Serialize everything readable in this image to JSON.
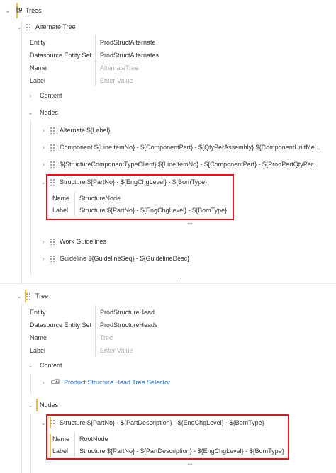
{
  "root": {
    "title": "Trees"
  },
  "alternate_tree": {
    "title": "Alternate Tree",
    "props": [
      {
        "key": "Entity",
        "value": "ProdStructAlternate",
        "placeholder": false
      },
      {
        "key": "Datasource Entity Set",
        "value": "ProdStructAlternates",
        "placeholder": false
      },
      {
        "key": "Name",
        "value": "AlternateTree",
        "placeholder": true
      },
      {
        "key": "Label",
        "value": "Enter Value",
        "placeholder": true
      }
    ],
    "content_label": "Content",
    "nodes_label": "Nodes",
    "nodes": [
      "Alternate ${Label}",
      "Component ${LineItemNo} - ${ComponentPart} - ${QtyPerAssembly} ${ComponentUnitMe...",
      "${StructureComponentTypeClient} ${LineItemNo} - ${ComponentPart} - ${ProdPartQtyPer...",
      "Structure ${PartNo} - ${EngChgLevel} - ${BomType}",
      "Work Guidelines",
      "Guideline ${GuidelineSeq} - ${GuidelineDesc}"
    ],
    "structure_props": [
      {
        "key": "Name",
        "value": "StructureNode"
      },
      {
        "key": "Label",
        "value": "Structure ${PartNo} - ${EngChgLevel} - ${BomType}"
      }
    ],
    "ellipsis": "...",
    "ellipsis_outer": "..."
  },
  "tree": {
    "title": "Tree",
    "props": [
      {
        "key": "Entity",
        "value": "ProdStructureHead",
        "placeholder": false
      },
      {
        "key": "Datasource Entity Set",
        "value": "ProdStructureHeads",
        "placeholder": false
      },
      {
        "key": "Name",
        "value": "Tree",
        "placeholder": true
      },
      {
        "key": "Label",
        "value": "Enter Value",
        "placeholder": true
      }
    ],
    "content_label": "Content",
    "selector_label": "Product Structure Head Tree Selector",
    "nodes_label": "Nodes",
    "root_node_title": "Structure ${PartNo} - ${PartDescription} - ${EngChgLevel} - ${BomType}",
    "root_node_props": [
      {
        "key": "Name",
        "value": "RootNode"
      },
      {
        "key": "Label",
        "value": "Structure ${PartNo} - ${PartDescription} - ${EngChgLevel} - ${BomType}"
      }
    ],
    "ellipsis": "..."
  },
  "colors": {
    "highlight": "#e0141e",
    "accent": "#f0c040",
    "link": "#2a6ebb"
  }
}
